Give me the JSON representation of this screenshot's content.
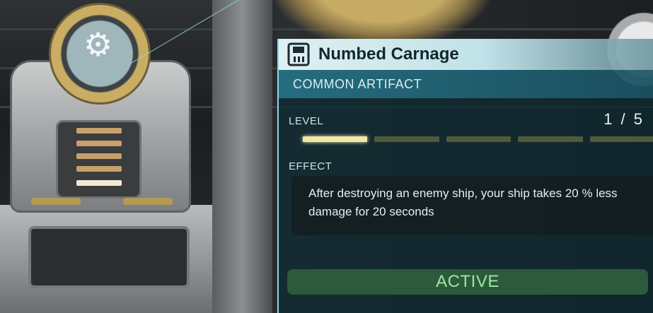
{
  "tooltip": {
    "title": "Numbed Carnage",
    "rarity": "COMMON ARTIFACT",
    "level_label": "LEVEL",
    "level_value": "1 / 5",
    "level_current": 1,
    "level_max": 5,
    "effect_label": "EFFECT",
    "effect_text": "After destroying an enemy ship, your ship takes 20 % less damage for 20 seconds",
    "status_button": "ACTIVE"
  },
  "colors": {
    "accent_cyan": "#8fd7e0",
    "level_fill": "#f1e7a6",
    "active_green": "#9be8a0"
  },
  "icons": {
    "title_icon": "artifact-card-icon",
    "artifact_glyph": "artifact-rune-icon"
  }
}
